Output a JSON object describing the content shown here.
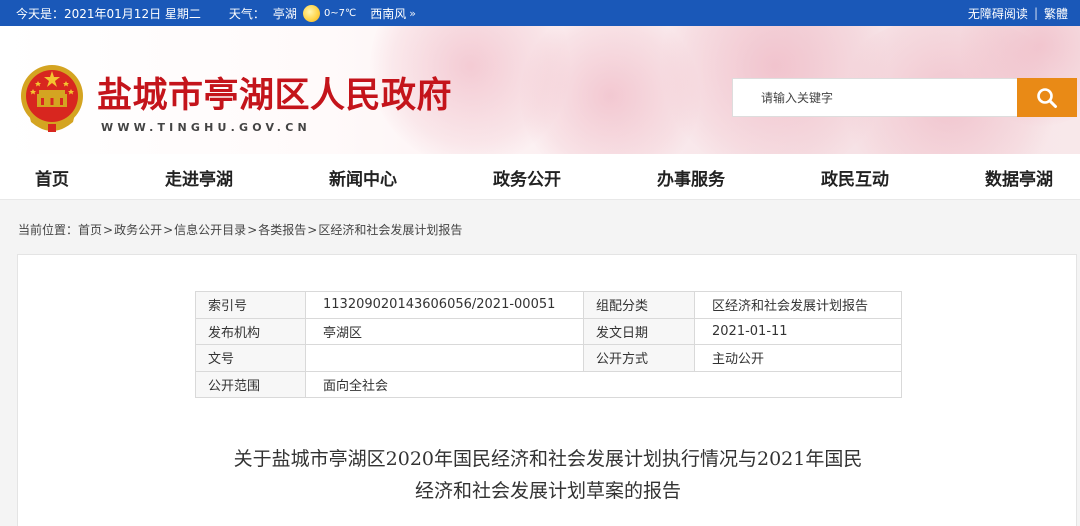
{
  "topbar": {
    "date": "今天是：2021年01月12日 星期二",
    "weather_label": "天气：",
    "city": "亭湖",
    "weather_icon": "sun-icon",
    "temperature": "0~7℃",
    "wind": "西南风",
    "more_glyph": "»",
    "accessibility": "无障碍阅读",
    "separator": "|",
    "traditional": "繁體"
  },
  "header": {
    "title": "盐城市亭湖区人民政府",
    "url": "WWW.TINGHU.GOV.CN",
    "emblem_icon": "national-emblem-icon",
    "search_placeholder": "请输入关键字",
    "search_icon": "search-icon"
  },
  "nav": {
    "items": [
      {
        "label": "首页"
      },
      {
        "label": "走进亭湖"
      },
      {
        "label": "新闻中心"
      },
      {
        "label": "政务公开"
      },
      {
        "label": "办事服务"
      },
      {
        "label": "政民互动"
      },
      {
        "label": "数据亭湖"
      }
    ]
  },
  "breadcrumb": {
    "prefix": "当前位置：",
    "separator": ">",
    "items": [
      "首页",
      "政务公开",
      "信息公开目录",
      "各类报告",
      "区经济和社会发展计划报告"
    ]
  },
  "meta": {
    "index_label": "索引号",
    "index_value": "113209020143606056/2021-00051",
    "category_label": "组配分类",
    "category_value": "区经济和社会发展计划报告",
    "publisher_label": "发布机构",
    "publisher_value": "亭湖区",
    "date_label": "发文日期",
    "date_value": "2021-01-11",
    "docno_label": "文号",
    "docno_value": "",
    "mode_label": "公开方式",
    "mode_value": "主动公开",
    "scope_label": "公开范围",
    "scope_value": "面向全社会"
  },
  "document": {
    "title_line1": "关于盐城市亭湖区2020年国民经济和社会发展计划执行情况与2021年国民",
    "title_line2": "经济和社会发展计划草案的报告"
  },
  "colors": {
    "topbar": "#1a58b8",
    "title_red": "#c4141b",
    "search_button": "#e98a16"
  }
}
